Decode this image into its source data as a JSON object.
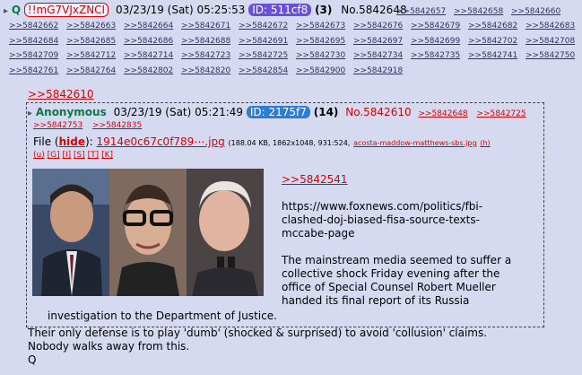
{
  "post": {
    "q_marker": "Q",
    "tripcode": "!!mG7VJxZNCI",
    "datetime": "03/23/19 (Sat) 05:25:53",
    "id_label": "ID: 511cf8",
    "reply_count": "(3)",
    "post_no": "No.5842648",
    "reply_links": [
      ">>5842657",
      ">>5842658",
      ">>5842660",
      ">>5842662",
      ">>5842663",
      ">>5842664",
      ">>5842671",
      ">>5842672",
      ">>5842673",
      ">>5842676",
      ">>5842679",
      ">>5842682",
      ">>5842683",
      ">>5842684",
      ">>5842685",
      ">>5842686",
      ">>5842688",
      ">>5842691",
      ">>5842695",
      ">>5842697",
      ">>5842699",
      ">>5842702",
      ">>5842708",
      ">>5842709",
      ">>5842712",
      ">>5842714",
      ">>5842723",
      ">>5842725",
      ">>5842730",
      ">>5842734",
      ">>5842735",
      ">>5842741",
      ">>5842750",
      ">>5842761",
      ">>5842764",
      ">>5842802",
      ">>5842820",
      ">>5842854",
      ">>5842900",
      ">>5842918"
    ],
    "quote_ref": ">>5842610",
    "footer_lines": [
      "Their only defense is to play 'dumb' (shocked & surprised) to avoid 'collusion' claims.",
      "Nobody walks away from this.",
      "Q"
    ]
  },
  "quoted": {
    "name": "Anonymous",
    "datetime": "03/23/19 (Sat) 05:21:49",
    "id_label": "ID: 2175f7",
    "reply_count": "(14)",
    "post_no": "No.5842610",
    "backlinks": [
      ">>5842648",
      ">>5842725",
      ">>5842753",
      ">>5842835"
    ],
    "file_label": "File",
    "hide_label": "hide",
    "file_name": "1914e0c67c0f789⋯.jpg",
    "file_meta": "(188.04 KB, 1862x1048, 931:524,",
    "file_orig": "acosta-maddow-matthews-sbs.jpg",
    "file_h": "(h)",
    "search_links": [
      "(u)",
      "[G]",
      "[I]",
      "[S]",
      "[T]",
      "[K]"
    ],
    "inner_ref": ">>5842541",
    "url_lines": [
      "https://www.foxnews.com/politics/fbi-",
      "clashed-doj-biased-fisa-source-texts-",
      "mccabe-page"
    ],
    "text_lines": [
      "The mainstream media seemed to suffer a",
      "collective shock Friday evening after the",
      "office of Special Counsel Robert Mueller",
      "handed its final report of its Russia"
    ],
    "last_line": "investigation to the Department of Justice."
  },
  "colors": {
    "background": "#d6daf0",
    "link": "#34345c",
    "red": "#dd0000",
    "name_green": "#117743",
    "id_purple": "#6a4fd8",
    "id_blue": "#2a7fd4"
  }
}
